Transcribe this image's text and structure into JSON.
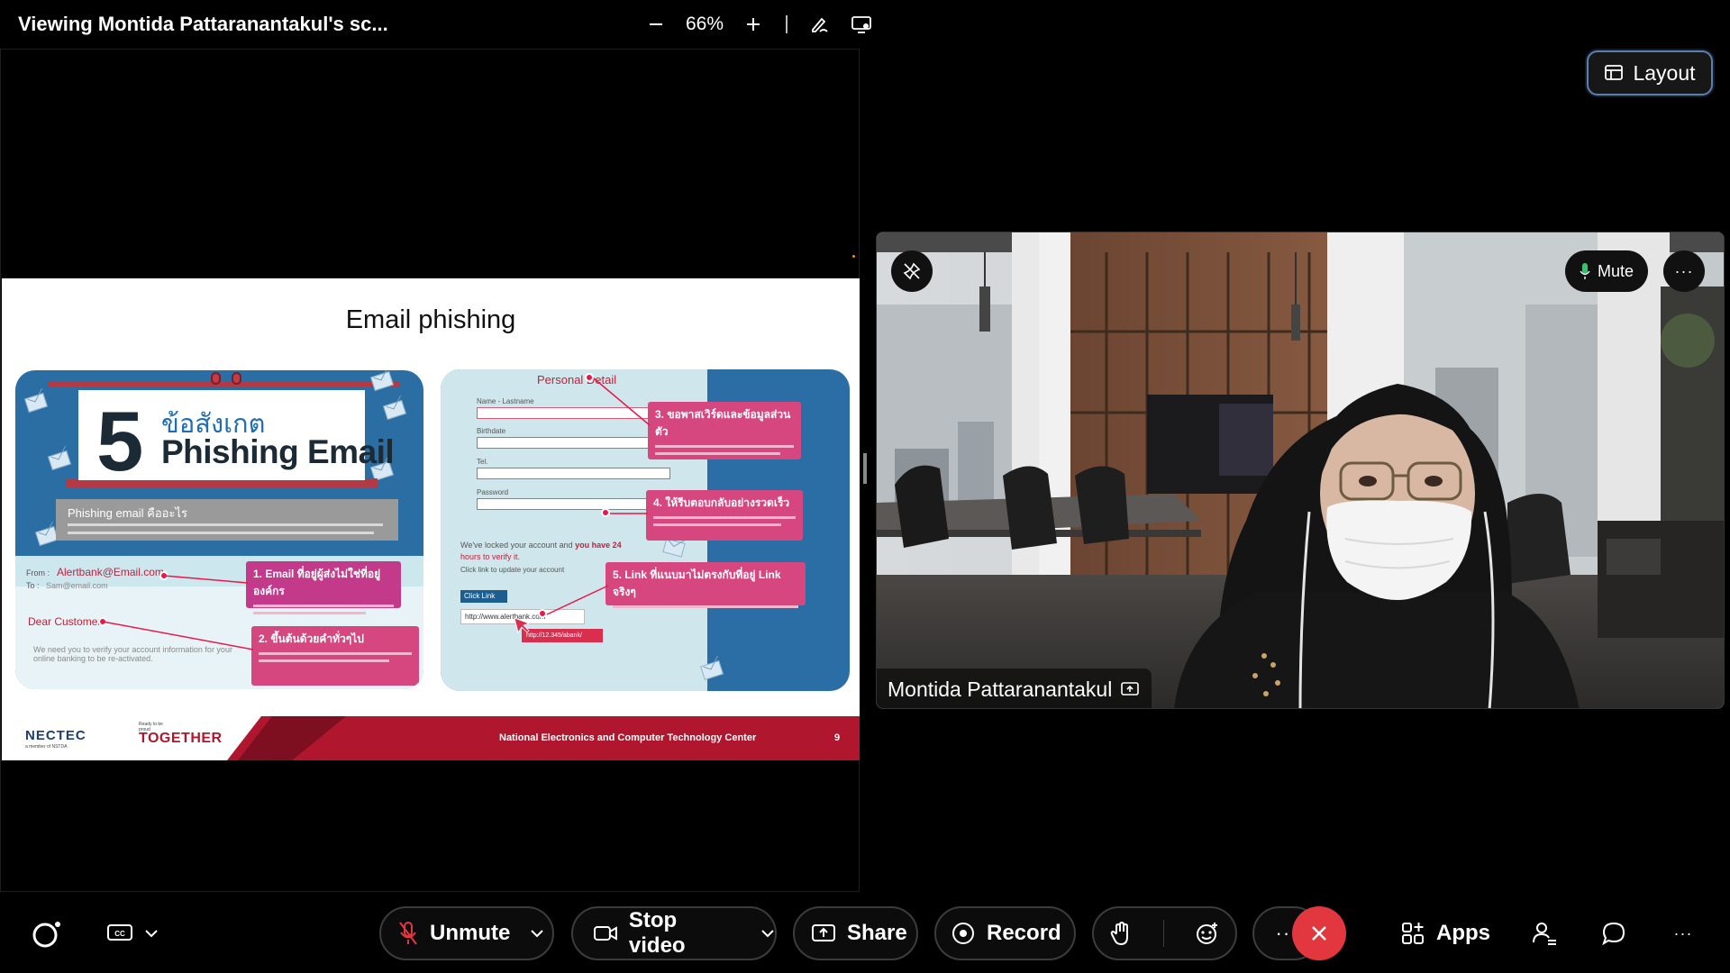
{
  "header": {
    "share_title": "Viewing Montida Pattaranantakul's sc...",
    "zoom_level": "66%",
    "zoom_out_icon": "minus-icon",
    "zoom_in_icon": "plus-icon",
    "annotate_icon": "annotate-pen-icon",
    "screen_icon": "screen-share-view-icon"
  },
  "layout_button": {
    "label": "Layout",
    "icon": "layout-icon"
  },
  "slide": {
    "title": "Email phishing",
    "left_card": {
      "number": "5",
      "thai_heading": "ข้อสังเกต",
      "heading": "Phishing Email",
      "question": "Phishing email คืออะไร",
      "from_label": "From :",
      "from_value": "Alertbank@Email.com",
      "to_label": "To :",
      "to_value": "Sam@email.com",
      "dear": "Dear  Customer",
      "body_text": "We need you to verify your account information for your online banking to be re-activated.",
      "callout1": "1. Email  ที่อยู่ผู้ส่งไม่ใช่ที่อยู่องค์กร",
      "callout2": "2. ขึ้นต้นด้วยคำทั่วๆไป"
    },
    "right_card": {
      "heading": "Personal  Detail",
      "fields": [
        "Name - Lastname",
        "Birthdate",
        "Tel.",
        "Password"
      ],
      "notice_prefix": "We've locked your account and",
      "notice_bold": "you have 24",
      "notice_line2": "hours to verify it.",
      "notice_line3": "Click link to update your account",
      "click_link": "Click Link",
      "url": "http://www.alertbank.com",
      "tooltip_url": "http://12.345/abank/",
      "callout3": "3. ขอพาสเวิร์ดและข้อมูลส่วนตัว",
      "callout4": "4. ให้รีบตอบกลับอย่างรวดเร็ว",
      "callout5": "5. Link ที่แนบมาไม่ตรงกับที่อยู่ Link จริงๆ"
    },
    "footer": {
      "nectec": "NECTEC",
      "nectec_sub": "a member of NSTDA",
      "ready_text": "Ready to be proud",
      "together": "TOGETHER",
      "org": "National Electronics and Computer Technology Center",
      "page_number": "9"
    }
  },
  "video": {
    "participant_name": "Montida Pattaranantakul",
    "mute_label": "Mute",
    "more_label": "···",
    "pin_icon": "unpin-icon",
    "sharing_icon": "sharing-screen-icon"
  },
  "toolbar": {
    "assistant_icon": "ai-assistant-icon",
    "captions_icon": "closed-captions-icon",
    "unmute_label": "Unmute",
    "stop_video_label": "Stop video",
    "share_label": "Share",
    "record_label": "Record",
    "raise_hand_icon": "raise-hand-icon",
    "reactions_icon": "reactions-icon",
    "more_label": "···",
    "leave_icon": "leave-meeting-icon",
    "apps_label": "Apps",
    "participants_icon": "participants-icon",
    "chat_icon": "chat-icon",
    "overflow_label": "···"
  },
  "colors": {
    "leave_red": "#e2373f",
    "layout_border": "#5d7faa",
    "slide_red": "#b0172e"
  }
}
